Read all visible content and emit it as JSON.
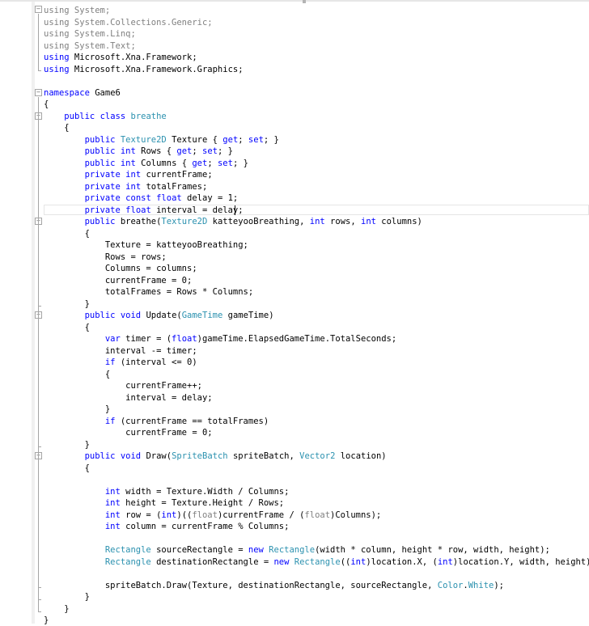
{
  "editor": {
    "lines": [
      {
        "segments": [
          {
            "t": "using System;",
            "c": "dim"
          }
        ]
      },
      {
        "segments": [
          {
            "t": "using System.Collections.Generic;",
            "c": "dim"
          }
        ]
      },
      {
        "segments": [
          {
            "t": "using System.Linq;",
            "c": "dim"
          }
        ]
      },
      {
        "segments": [
          {
            "t": "using System.Text;",
            "c": "dim"
          }
        ]
      },
      {
        "segments": [
          {
            "t": "using",
            "c": "kw"
          },
          {
            "t": " Microsoft.Xna.Framework;"
          }
        ]
      },
      {
        "segments": [
          {
            "t": "using",
            "c": "kw"
          },
          {
            "t": " Microsoft.Xna.Framework.Graphics;"
          }
        ]
      },
      {
        "segments": []
      },
      {
        "segments": [
          {
            "t": "namespace",
            "c": "kw"
          },
          {
            "t": " Game6"
          }
        ]
      },
      {
        "segments": [
          {
            "t": "{"
          }
        ]
      },
      {
        "segments": [
          {
            "t": "    "
          },
          {
            "t": "public",
            "c": "kw"
          },
          {
            "t": " "
          },
          {
            "t": "class",
            "c": "kw"
          },
          {
            "t": " "
          },
          {
            "t": "breathe",
            "c": "ty"
          }
        ]
      },
      {
        "segments": [
          {
            "t": "    {"
          }
        ]
      },
      {
        "segments": [
          {
            "t": "        "
          },
          {
            "t": "public",
            "c": "kw"
          },
          {
            "t": " "
          },
          {
            "t": "Texture2D",
            "c": "ty"
          },
          {
            "t": " Texture { "
          },
          {
            "t": "get",
            "c": "kw"
          },
          {
            "t": "; "
          },
          {
            "t": "set",
            "c": "kw"
          },
          {
            "t": "; }"
          }
        ]
      },
      {
        "segments": [
          {
            "t": "        "
          },
          {
            "t": "public",
            "c": "kw"
          },
          {
            "t": " "
          },
          {
            "t": "int",
            "c": "kw"
          },
          {
            "t": " Rows { "
          },
          {
            "t": "get",
            "c": "kw"
          },
          {
            "t": "; "
          },
          {
            "t": "set",
            "c": "kw"
          },
          {
            "t": "; }"
          }
        ]
      },
      {
        "segments": [
          {
            "t": "        "
          },
          {
            "t": "public",
            "c": "kw"
          },
          {
            "t": " "
          },
          {
            "t": "int",
            "c": "kw"
          },
          {
            "t": " Columns { "
          },
          {
            "t": "get",
            "c": "kw"
          },
          {
            "t": "; "
          },
          {
            "t": "set",
            "c": "kw"
          },
          {
            "t": "; }"
          }
        ]
      },
      {
        "segments": [
          {
            "t": "        "
          },
          {
            "t": "private",
            "c": "kw"
          },
          {
            "t": " "
          },
          {
            "t": "int",
            "c": "kw"
          },
          {
            "t": " currentFrame;"
          }
        ]
      },
      {
        "segments": [
          {
            "t": "        "
          },
          {
            "t": "private",
            "c": "kw"
          },
          {
            "t": " "
          },
          {
            "t": "int",
            "c": "kw"
          },
          {
            "t": " totalFrames;"
          }
        ]
      },
      {
        "segments": [
          {
            "t": "        "
          },
          {
            "t": "private",
            "c": "kw"
          },
          {
            "t": " "
          },
          {
            "t": "const",
            "c": "kw"
          },
          {
            "t": " "
          },
          {
            "t": "float",
            "c": "kw"
          },
          {
            "t": " delay = 1;"
          }
        ]
      },
      {
        "segments": [
          {
            "t": "        "
          },
          {
            "t": "private",
            "c": "kw"
          },
          {
            "t": " "
          },
          {
            "t": "float",
            "c": "kw"
          },
          {
            "t": " interval = delay;"
          }
        ]
      },
      {
        "segments": [
          {
            "t": "        "
          },
          {
            "t": "public",
            "c": "kw"
          },
          {
            "t": " breathe("
          },
          {
            "t": "Texture2D",
            "c": "ty"
          },
          {
            "t": " katteyooBreathing, "
          },
          {
            "t": "int",
            "c": "kw"
          },
          {
            "t": " rows, "
          },
          {
            "t": "int",
            "c": "kw"
          },
          {
            "t": " columns)"
          }
        ]
      },
      {
        "segments": [
          {
            "t": "        {"
          }
        ]
      },
      {
        "segments": [
          {
            "t": "            Texture = katteyooBreathing;"
          }
        ]
      },
      {
        "segments": [
          {
            "t": "            Rows = rows;"
          }
        ]
      },
      {
        "segments": [
          {
            "t": "            Columns = columns;"
          }
        ]
      },
      {
        "segments": [
          {
            "t": "            currentFrame = 0;"
          }
        ]
      },
      {
        "segments": [
          {
            "t": "            totalFrames = Rows * Columns;"
          }
        ]
      },
      {
        "segments": [
          {
            "t": "        }"
          }
        ]
      },
      {
        "segments": [
          {
            "t": "        "
          },
          {
            "t": "public",
            "c": "kw"
          },
          {
            "t": " "
          },
          {
            "t": "void",
            "c": "kw"
          },
          {
            "t": " Update("
          },
          {
            "t": "GameTime",
            "c": "ty"
          },
          {
            "t": " gameTime)"
          }
        ]
      },
      {
        "segments": [
          {
            "t": "        {"
          }
        ]
      },
      {
        "segments": [
          {
            "t": "            "
          },
          {
            "t": "var",
            "c": "kw"
          },
          {
            "t": " timer = ("
          },
          {
            "t": "float",
            "c": "kw"
          },
          {
            "t": ")gameTime.ElapsedGameTime.TotalSeconds;"
          }
        ]
      },
      {
        "segments": [
          {
            "t": "            interval -= timer;"
          }
        ]
      },
      {
        "segments": [
          {
            "t": "            "
          },
          {
            "t": "if",
            "c": "kw"
          },
          {
            "t": " (interval <= 0)"
          }
        ]
      },
      {
        "segments": [
          {
            "t": "            {"
          }
        ]
      },
      {
        "segments": [
          {
            "t": "                currentFrame++;"
          }
        ]
      },
      {
        "segments": [
          {
            "t": "                interval = delay;"
          }
        ]
      },
      {
        "segments": [
          {
            "t": "            }"
          }
        ]
      },
      {
        "segments": [
          {
            "t": "            "
          },
          {
            "t": "if",
            "c": "kw"
          },
          {
            "t": " (currentFrame == totalFrames)"
          }
        ]
      },
      {
        "segments": [
          {
            "t": "                currentFrame = 0;"
          }
        ]
      },
      {
        "segments": [
          {
            "t": "        }"
          }
        ]
      },
      {
        "segments": [
          {
            "t": "        "
          },
          {
            "t": "public",
            "c": "kw"
          },
          {
            "t": " "
          },
          {
            "t": "void",
            "c": "kw"
          },
          {
            "t": " Draw("
          },
          {
            "t": "SpriteBatch",
            "c": "ty"
          },
          {
            "t": " spriteBatch, "
          },
          {
            "t": "Vector2",
            "c": "ty"
          },
          {
            "t": " location)"
          }
        ]
      },
      {
        "segments": [
          {
            "t": "        {"
          }
        ]
      },
      {
        "segments": []
      },
      {
        "segments": [
          {
            "t": "            "
          },
          {
            "t": "int",
            "c": "kw"
          },
          {
            "t": " width = Texture.Width / Columns;"
          }
        ]
      },
      {
        "segments": [
          {
            "t": "            "
          },
          {
            "t": "int",
            "c": "kw"
          },
          {
            "t": " height = Texture.Height / Rows;"
          }
        ]
      },
      {
        "segments": [
          {
            "t": "            "
          },
          {
            "t": "int",
            "c": "kw"
          },
          {
            "t": " row = ("
          },
          {
            "t": "int",
            "c": "kw"
          },
          {
            "t": ")(("
          },
          {
            "t": "float",
            "c": "dim"
          },
          {
            "t": ")currentFrame / ("
          },
          {
            "t": "float",
            "c": "dim"
          },
          {
            "t": ")Columns);"
          }
        ]
      },
      {
        "segments": [
          {
            "t": "            "
          },
          {
            "t": "int",
            "c": "kw"
          },
          {
            "t": " column = currentFrame % Columns;"
          }
        ]
      },
      {
        "segments": []
      },
      {
        "segments": [
          {
            "t": "            "
          },
          {
            "t": "Rectangle",
            "c": "ty"
          },
          {
            "t": " sourceRectangle = "
          },
          {
            "t": "new",
            "c": "kw"
          },
          {
            "t": " "
          },
          {
            "t": "Rectangle",
            "c": "ty"
          },
          {
            "t": "(width * column, height * row, width, height);"
          }
        ]
      },
      {
        "segments": [
          {
            "t": "            "
          },
          {
            "t": "Rectangle",
            "c": "ty"
          },
          {
            "t": " destinationRectangle = "
          },
          {
            "t": "new",
            "c": "kw"
          },
          {
            "t": " "
          },
          {
            "t": "Rectangle",
            "c": "ty"
          },
          {
            "t": "(("
          },
          {
            "t": "int",
            "c": "kw"
          },
          {
            "t": ")location.X, ("
          },
          {
            "t": "int",
            "c": "kw"
          },
          {
            "t": ")location.Y, width, height);"
          }
        ]
      },
      {
        "segments": []
      },
      {
        "segments": [
          {
            "t": "            spriteBatch.Draw(Texture, destinationRectangle, sourceRectangle, "
          },
          {
            "t": "Color",
            "c": "ty"
          },
          {
            "t": "."
          },
          {
            "t": "White",
            "c": "ty"
          },
          {
            "t": ");"
          }
        ]
      },
      {
        "segments": [
          {
            "t": "        }"
          }
        ]
      },
      {
        "segments": [
          {
            "t": "    }"
          }
        ]
      },
      {
        "segments": [
          {
            "t": "}"
          }
        ]
      }
    ],
    "fold_markers": {
      "collapsed": "+",
      "expanded": "−"
    }
  },
  "colors": {
    "keyword": "#0000ff",
    "type": "#2b91af",
    "dimmed": "#808080",
    "text": "#000000"
  }
}
